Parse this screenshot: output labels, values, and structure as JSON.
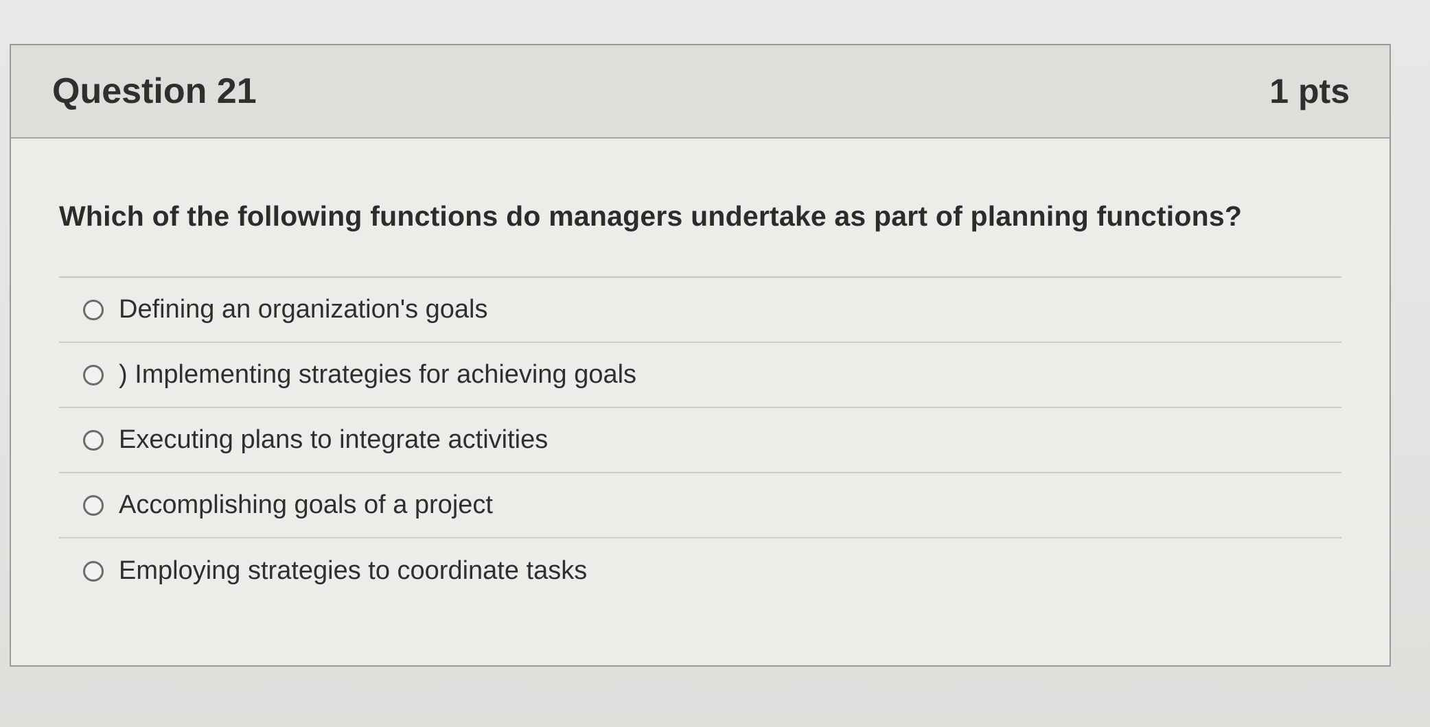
{
  "question": {
    "name": "Question 21",
    "points": "1 pts",
    "text": "Which of the following functions do managers undertake as part of planning functions?"
  },
  "answers": [
    {
      "label": "Defining an organization's goals",
      "selected": false
    },
    {
      "label": ") Implementing strategies for achieving goals",
      "selected": false
    },
    {
      "label": "Executing plans to integrate activities",
      "selected": false
    },
    {
      "label": "Accomplishing goals of a project",
      "selected": false
    },
    {
      "label": "Employing strategies to coordinate tasks",
      "selected": false
    }
  ]
}
